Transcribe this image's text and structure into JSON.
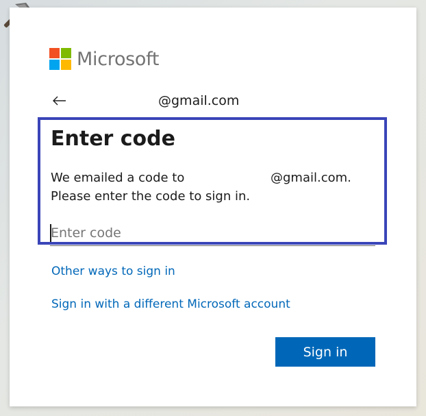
{
  "brand": {
    "name": "Microsoft",
    "colors": [
      "#f25022",
      "#7fba00",
      "#00a4ef",
      "#ffb900"
    ]
  },
  "identity": {
    "back_icon": "arrow-left-icon",
    "email": "@gmail.com"
  },
  "main": {
    "title": "Enter code",
    "description_prefix": "We emailed a code to",
    "description_email": "@gmail.com.",
    "description_line2": "Please enter the code to sign in.",
    "code_placeholder": "Enter code",
    "code_value": ""
  },
  "links": {
    "other_ways": "Other ways to sign in",
    "different_account": "Sign in with a different Microsoft account"
  },
  "actions": {
    "sign_in": "Sign in"
  },
  "colors": {
    "accent": "#0067b8",
    "highlight_border": "#3a45b8",
    "text": "#1b1b1b"
  }
}
